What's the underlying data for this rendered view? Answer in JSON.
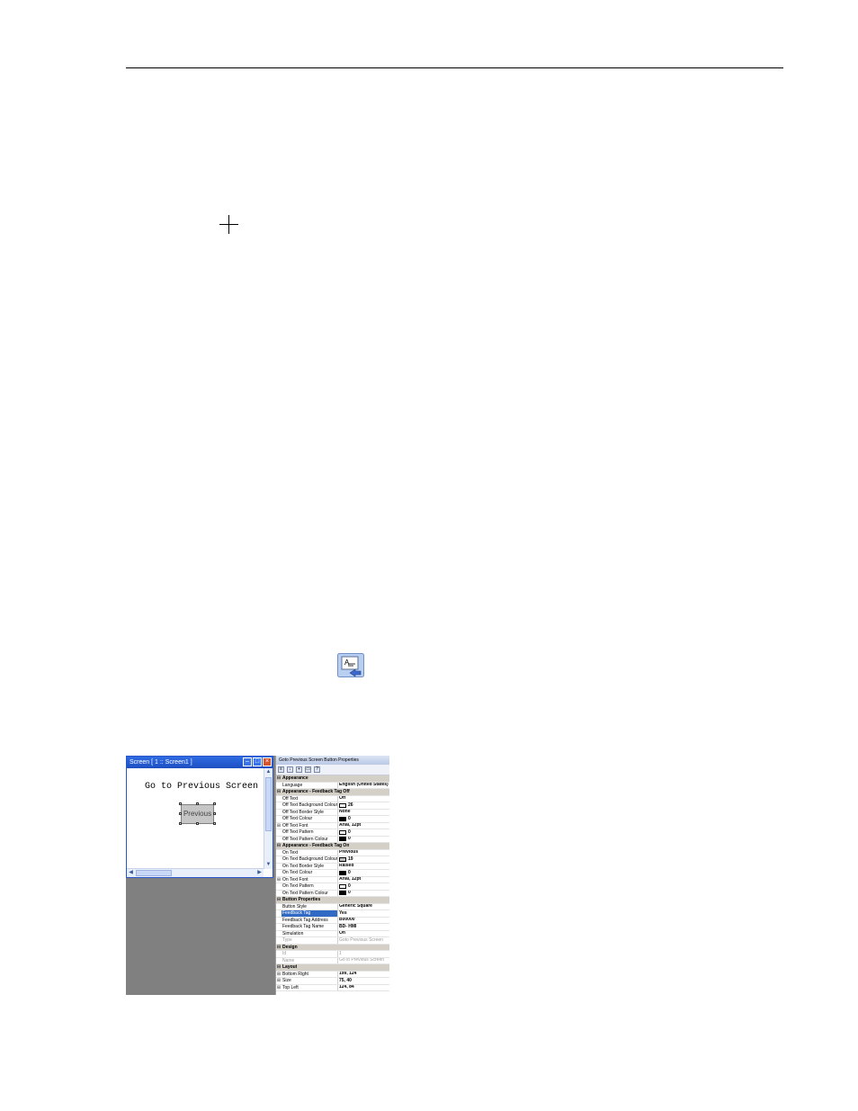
{
  "screen_window": {
    "title": "Screen [ 1 :: Screen1 ]",
    "heading": "Go to Previous Screen",
    "button_label": "Previous"
  },
  "properties": {
    "title": "Goto Previous Screen Button Properties",
    "rows": [
      {
        "type": "cat",
        "exp": "⊟",
        "key": "Appearance"
      },
      {
        "key": "Language",
        "val": "English (United States)"
      },
      {
        "type": "cat",
        "exp": "⊟",
        "key": "Appearance - Feedback Tag Off"
      },
      {
        "key": "Off Text",
        "val": "Off"
      },
      {
        "key": "Off Text Background Colour",
        "val": "26",
        "swatch": "#ffffff"
      },
      {
        "key": "Off Text Border Style",
        "val": "None"
      },
      {
        "key": "Off Text Colour",
        "val": "0",
        "swatch": "#000000"
      },
      {
        "exp": "⊞",
        "key": "Off Text Font",
        "val": "Arial, 12pt"
      },
      {
        "key": "Off Text Pattern",
        "val": "0",
        "swatch": "#ffffff"
      },
      {
        "key": "Off Text Pattern Colour",
        "val": "0",
        "swatch": "#000000"
      },
      {
        "type": "cat",
        "exp": "⊟",
        "key": "Appearance - Feedback Tag On"
      },
      {
        "key": "On Text",
        "val": "Previous"
      },
      {
        "key": "On Text Background Colour",
        "val": "19",
        "swatch": "#c0c0c0"
      },
      {
        "key": "On Text Border Style",
        "val": "Raised"
      },
      {
        "key": "On Text Colour",
        "val": "0",
        "swatch": "#000000"
      },
      {
        "exp": "⊞",
        "key": "On Text Font",
        "val": "Arial, 12pt"
      },
      {
        "key": "On Text Pattern",
        "val": "0",
        "swatch": "#ffffff"
      },
      {
        "key": "On Text Pattern Colour",
        "val": "0",
        "swatch": "#000000"
      },
      {
        "type": "cat",
        "exp": "⊟",
        "key": "Button Properties"
      },
      {
        "key": "Button Style",
        "val": "Generic Square"
      },
      {
        "key": "Feedback Tag",
        "val": "Yes",
        "selected": true
      },
      {
        "key": "Feedback Tag Address",
        "val": "B00000"
      },
      {
        "key": "Feedback Tag Name",
        "val": "BD- HMI"
      },
      {
        "key": "Simulation",
        "val": "On"
      },
      {
        "key": "Type",
        "val": "Goto Previous Screen",
        "dim": true
      },
      {
        "type": "cat",
        "exp": "⊟",
        "key": "Design"
      },
      {
        "key": "Id",
        "val": "1",
        "dim": true
      },
      {
        "key": "Name",
        "val": "GoTo Previous Screen",
        "dim": true
      },
      {
        "type": "cat",
        "exp": "⊟",
        "key": "Layout"
      },
      {
        "exp": "⊞",
        "key": "Bottom Right",
        "val": "199, 124"
      },
      {
        "exp": "⊞",
        "key": "Size",
        "val": "75, 40"
      },
      {
        "exp": "⊞",
        "key": "Top Left",
        "val": "124, 84"
      }
    ]
  },
  "colors": {
    "window_title": "#2f6be3",
    "selection": "#316ac5",
    "workspace": "#808080"
  },
  "icons": [
    "crosshair-cursor-icon",
    "goto-previous-screen-tool-icon"
  ]
}
